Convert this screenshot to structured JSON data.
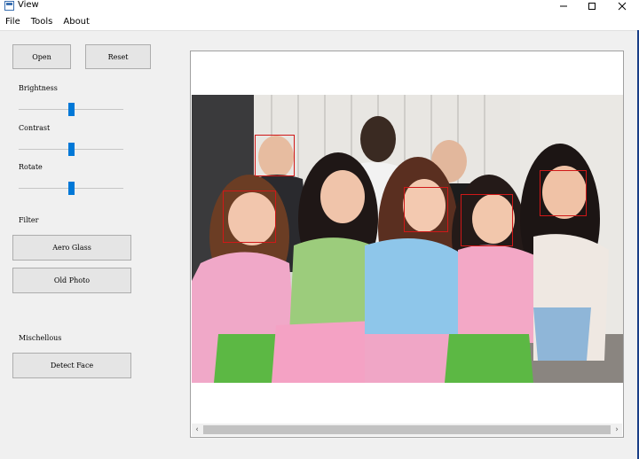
{
  "window": {
    "title": "View"
  },
  "menu": [
    "File",
    "Tools",
    "About"
  ],
  "buttons": {
    "open": "Open",
    "reset": "Reset",
    "aero_glass": "Aero Glass",
    "old_photo": "Old Photo",
    "detect_face": "Detect Face"
  },
  "labels": {
    "brightness": "Brightness",
    "contrast": "Contrast",
    "rotate": "Rotate",
    "filter": "Filter",
    "misc": "Mischellous"
  },
  "sliders": {
    "brightness": 0.5,
    "contrast": 0.5,
    "rotate": 0.5
  },
  "colors": {
    "accent": "#0078d7",
    "face_box": "#d01818"
  }
}
